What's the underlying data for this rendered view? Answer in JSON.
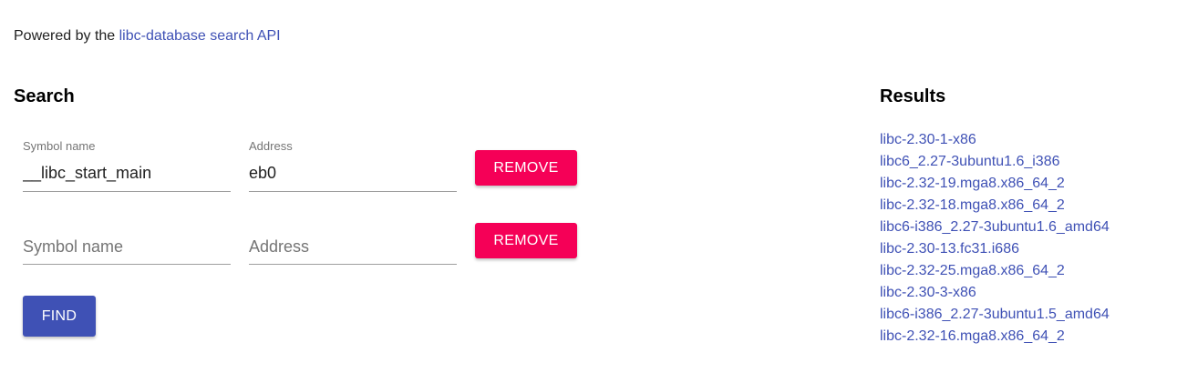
{
  "powered": {
    "prefix": "Powered by the ",
    "link_text": "libc-database search API"
  },
  "search": {
    "heading": "Search",
    "rows": [
      {
        "symbol_label": "Symbol name",
        "symbol_value": "__libc_start_main",
        "address_label": "Address",
        "address_value": "eb0",
        "remove_label": "REMOVE"
      },
      {
        "symbol_placeholder": "Symbol name",
        "address_placeholder": "Address",
        "remove_label": "REMOVE"
      }
    ],
    "find_label": "FIND"
  },
  "results": {
    "heading": "Results",
    "items": [
      "libc-2.30-1-x86",
      "libc6_2.27-3ubuntu1.6_i386",
      "libc-2.32-19.mga8.x86_64_2",
      "libc-2.32-18.mga8.x86_64_2",
      "libc6-i386_2.27-3ubuntu1.6_amd64",
      "libc-2.30-13.fc31.i686",
      "libc-2.32-25.mga8.x86_64_2",
      "libc-2.30-3-x86",
      "libc6-i386_2.27-3ubuntu1.5_amd64",
      "libc-2.32-16.mga8.x86_64_2"
    ]
  },
  "colors": {
    "primary": "#3f51b5",
    "accent": "#f50057"
  }
}
